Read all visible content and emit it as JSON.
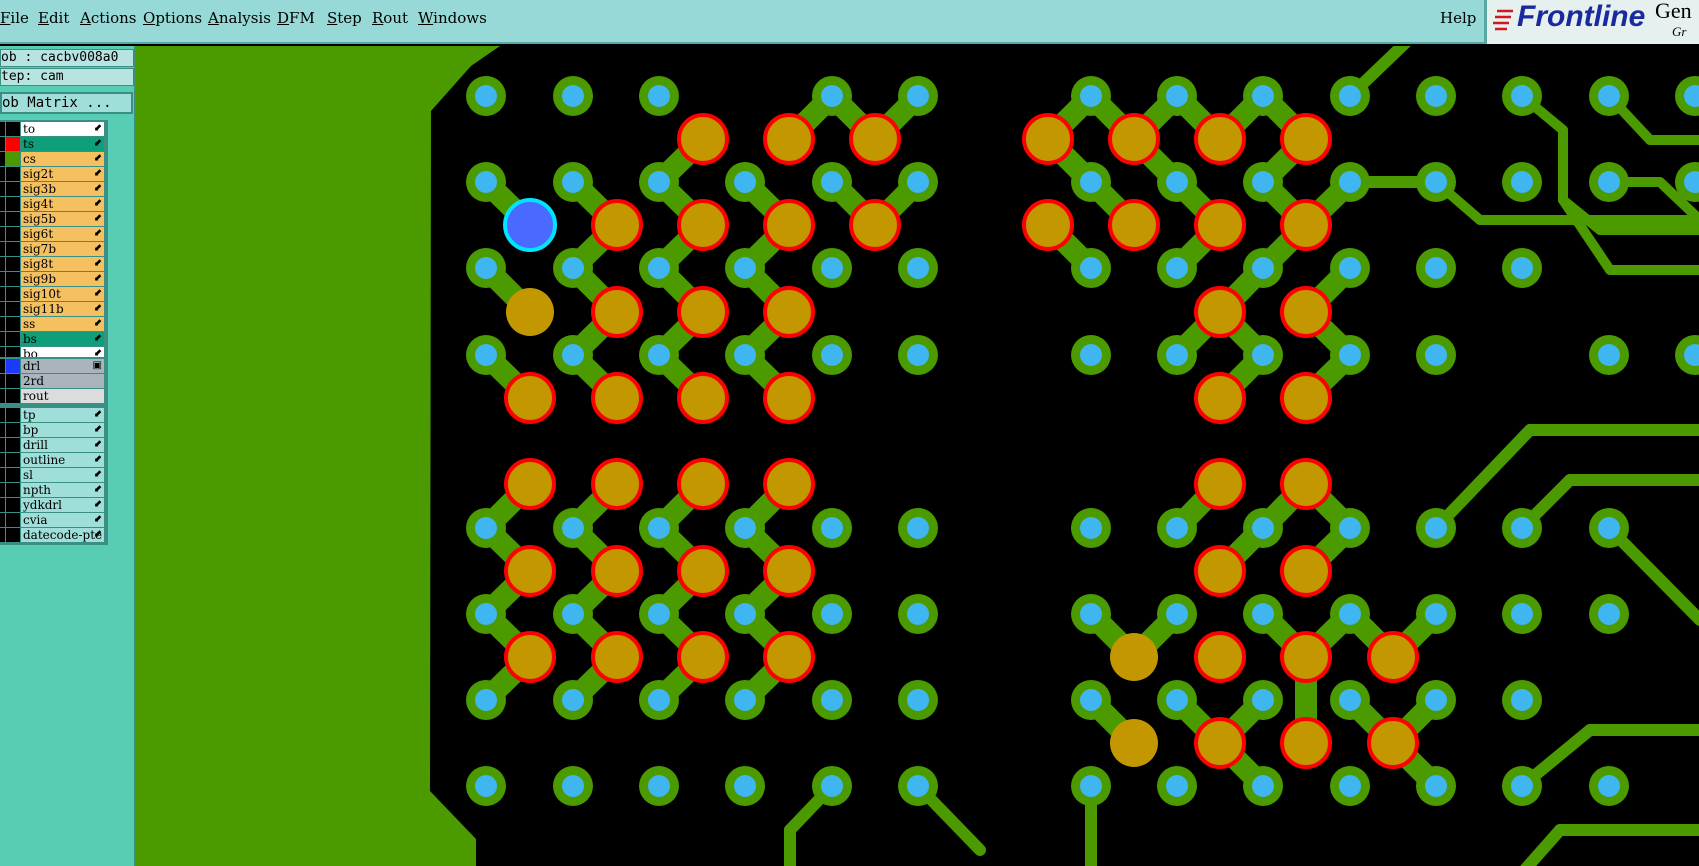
{
  "menu": {
    "items": [
      "File",
      "Edit",
      "Actions",
      "Options",
      "Analysis",
      "DFM",
      "Step",
      "Rout",
      "Windows"
    ],
    "help": "Help"
  },
  "logo": {
    "name": "Frontline",
    "product": "Gen",
    "sub": "Gr"
  },
  "panel": {
    "job": "ob : cacbv008a0",
    "step": "tep: cam",
    "matrix_button": "ob Matrix ..."
  },
  "layers": {
    "board": [
      {
        "name": "to",
        "swatch": "#000000",
        "bg": "#ffffff"
      },
      {
        "name": "ts",
        "swatch": "#ff0000",
        "bg": "#0f9e7a"
      },
      {
        "name": "cs",
        "swatch": "#4a9a00",
        "bg": "#f5c060"
      },
      {
        "name": "sig2t",
        "swatch": "#000000",
        "bg": "#f5c060"
      },
      {
        "name": "sig3b",
        "swatch": "#000000",
        "bg": "#f5c060"
      },
      {
        "name": "sig4t",
        "swatch": "#000000",
        "bg": "#f5c060"
      },
      {
        "name": "sig5b",
        "swatch": "#000000",
        "bg": "#f5c060"
      },
      {
        "name": "sig6t",
        "swatch": "#000000",
        "bg": "#f5c060"
      },
      {
        "name": "sig7b",
        "swatch": "#000000",
        "bg": "#f5c060"
      },
      {
        "name": "sig8t",
        "swatch": "#000000",
        "bg": "#f5c060"
      },
      {
        "name": "sig9b",
        "swatch": "#000000",
        "bg": "#f5c060"
      },
      {
        "name": "sig10t",
        "swatch": "#000000",
        "bg": "#f5c060"
      },
      {
        "name": "sig11b",
        "swatch": "#000000",
        "bg": "#f5c060"
      },
      {
        "name": "ss",
        "swatch": "#000000",
        "bg": "#f5c060"
      },
      {
        "name": "bs",
        "swatch": "#000000",
        "bg": "#0f9e7a"
      },
      {
        "name": "bo",
        "swatch": "#000000",
        "bg": "#ffffff"
      }
    ],
    "drill": [
      {
        "name": "drl",
        "swatch": "#1a3aff",
        "bg": "#a9b4bc"
      },
      {
        "name": "2rd",
        "swatch": "#000000",
        "bg": "#a9b4bc"
      },
      {
        "name": "rout",
        "swatch": "#000000",
        "bg": "#dcdcdc"
      }
    ],
    "misc": [
      {
        "name": "tp",
        "swatch": "#000000",
        "bg": "#9fded9"
      },
      {
        "name": "bp",
        "swatch": "#000000",
        "bg": "#9fded9"
      },
      {
        "name": "drill",
        "swatch": "#000000",
        "bg": "#9fded9"
      },
      {
        "name": "outline",
        "swatch": "#000000",
        "bg": "#9fded9"
      },
      {
        "name": "sl",
        "swatch": "#000000",
        "bg": "#9fded9"
      },
      {
        "name": "npth",
        "swatch": "#000000",
        "bg": "#9fded9"
      },
      {
        "name": "ydkdrl",
        "swatch": "#000000",
        "bg": "#9fded9"
      },
      {
        "name": "cvia",
        "swatch": "#000000",
        "bg": "#9fded9"
      },
      {
        "name": "datecode-pte",
        "swatch": "#000000",
        "bg": "#9fded9"
      }
    ]
  },
  "colors": {
    "copper": "#4a9a00",
    "via": "#3fb6f0",
    "pad": "#c29700",
    "pad_ring": "#ff0000",
    "highlight": "#4a6aff",
    "highlight_ring": "#00e5ff",
    "background": "#000000",
    "menubar": "#96d9d6",
    "panel": "#57cdb3"
  }
}
